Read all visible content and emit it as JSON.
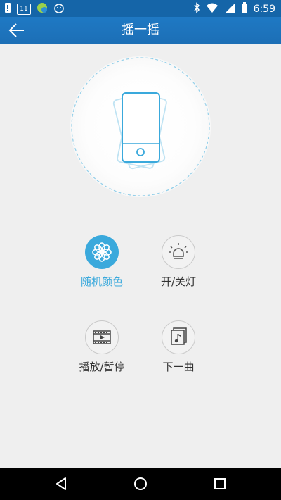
{
  "status_bar": {
    "time": "6:59",
    "notification_badge": "11",
    "icons": [
      "alert-icon",
      "notification-icon",
      "app-icon",
      "android-icon",
      "bluetooth-icon",
      "wifi-icon",
      "signal-icon",
      "battery-icon"
    ]
  },
  "toolbar": {
    "title": "摇一摇",
    "back_icon": "back-arrow-icon"
  },
  "shake": {
    "icon": "phone-shake-icon"
  },
  "actions": [
    {
      "label": "随机颜色",
      "icon": "flower-icon",
      "active": true
    },
    {
      "label": "开/关灯",
      "icon": "bulb-icon",
      "active": false
    },
    {
      "label": "播放/暂停",
      "icon": "film-play-icon",
      "active": false
    },
    {
      "label": "下一曲",
      "icon": "music-note-icon",
      "active": false
    }
  ],
  "colors": {
    "status_bar": "#1565a8",
    "toolbar": "#1c6fb6",
    "accent": "#3aa9dc",
    "background": "#efefef",
    "text": "#333333"
  },
  "nav_bar": {
    "buttons": [
      "back-triangle-icon",
      "home-circle-icon",
      "recents-square-icon"
    ]
  }
}
